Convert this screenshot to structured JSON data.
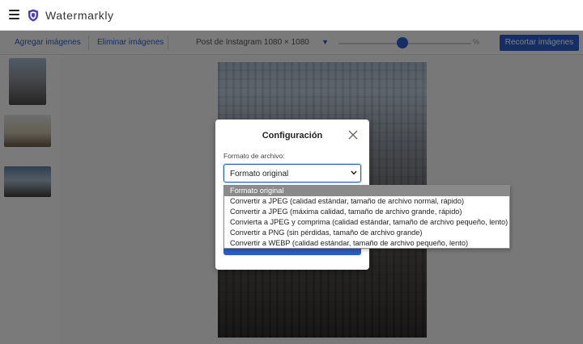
{
  "app": {
    "title": "Watermarkly"
  },
  "toolbar": {
    "add_images": "Agregar imágenes",
    "remove_images": "Eliminar imágenes",
    "preset": "Post de Instagram 1080 × 1080",
    "zoom_label": "%",
    "crop_button": "Recortar imágenes"
  },
  "modal": {
    "title": "Configuración",
    "field_label": "Formato de archivo:",
    "selected_value": "Formato original"
  },
  "dropdown": {
    "options": [
      "Formato original",
      "Convertir a JPEG (calidad estándar, tamaño de archivo normal, rápido)",
      "Convertir a JPEG (máxima calidad, tamaño de archivo grande, rápido)",
      "Convierta a JPEG y comprima (calidad estándar, tamaño de archivo pequeño, lento)",
      "Convertir a PNG (sin pérdidas, tamaño de archivo grande)",
      "Convertir a WEBP (calidad estándar, tamaño de archivo pequeño, lento)"
    ],
    "selected_index": 0
  },
  "colors": {
    "accent": "#2a5dc9",
    "logo": "#4b3bbf",
    "overlay": "rgba(0,0,0,0.5)"
  },
  "icons": [
    "hamburger-menu-icon",
    "shield-logo-icon",
    "close-icon",
    "chevron-down-icon"
  ]
}
